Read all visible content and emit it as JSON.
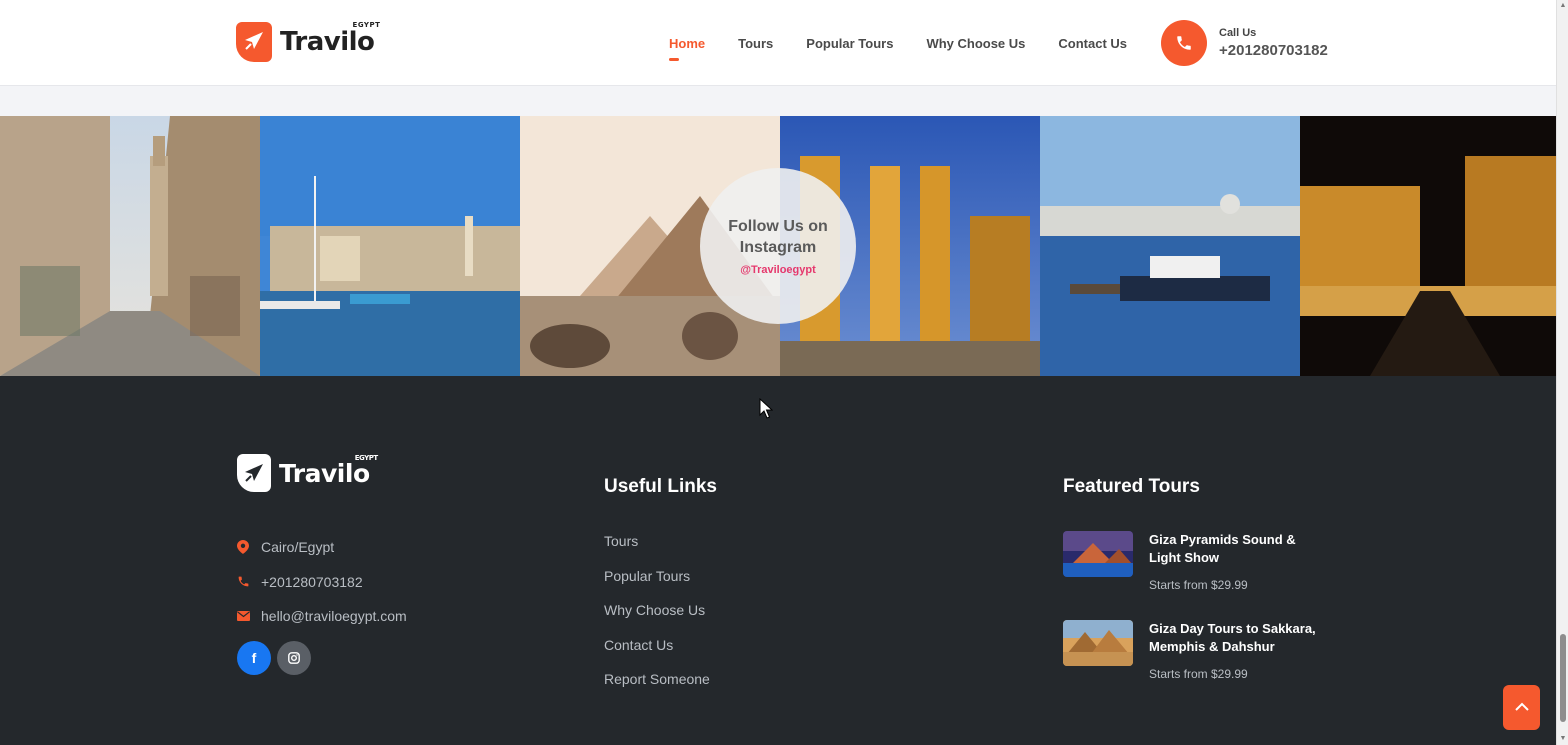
{
  "header": {
    "logo": {
      "brand": "Travilo",
      "sub": "EGYPT"
    },
    "nav": [
      {
        "label": "Home",
        "active": true
      },
      {
        "label": "Tours",
        "active": false
      },
      {
        "label": "Popular Tours",
        "active": false
      },
      {
        "label": "Why Choose Us",
        "active": false
      },
      {
        "label": "Contact Us",
        "active": false
      }
    ],
    "call": {
      "label": "Call Us",
      "number": "+201280703182",
      "icon": "phone-icon"
    }
  },
  "instagram": {
    "title": "Follow Us on Instagram",
    "handle": "@Traviloegypt",
    "tiles": [
      "old-cairo-street",
      "nile-sailboat",
      "giza-pyramid",
      "luxor-temple-night",
      "nile-city-boat",
      "karnak-avenue-night"
    ]
  },
  "footer": {
    "logo": {
      "brand": "Travilo",
      "sub": "EGYPT"
    },
    "contact": [
      {
        "icon": "location-pin-icon",
        "text": "Cairo/Egypt"
      },
      {
        "icon": "phone-icon",
        "text": "+201280703182"
      },
      {
        "icon": "envelope-icon",
        "text": "hello@traviloegypt.com"
      }
    ],
    "social": [
      {
        "icon": "facebook-icon",
        "glyph": "f"
      },
      {
        "icon": "instagram-icon",
        "glyph": ""
      }
    ],
    "useful_links": {
      "title": "Useful Links",
      "items": [
        "Tours",
        "Popular Tours",
        "Why Choose Us",
        "Contact Us",
        "Report Someone"
      ]
    },
    "featured_tours": {
      "title": "Featured Tours",
      "items": [
        {
          "title": "Giza Pyramids Sound & Light Show",
          "price": "Starts from $29.99"
        },
        {
          "title": "Giza Day Tours to Sakkara, Memphis & Dahshur",
          "price": "Starts from $29.99"
        }
      ]
    }
  },
  "colors": {
    "accent": "#f5592e",
    "footer_bg": "#24282c",
    "instagram_handle": "#e5386d"
  }
}
